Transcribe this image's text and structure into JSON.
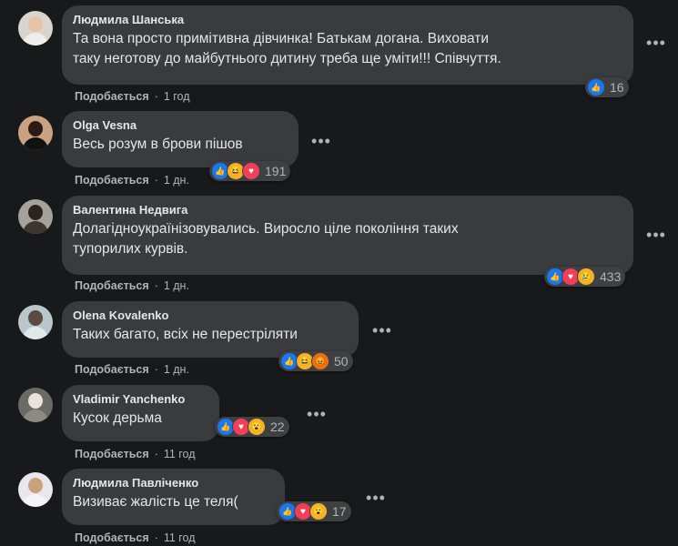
{
  "comments": [
    {
      "author": "Людмила Шанська",
      "text": "Та вона просто примітивна дівчинка! Батькам догана. Виховати\nтаку неготову до майбутнього дитину треба ще уміти!!! Співчуття.",
      "like_label": "Подобається",
      "time": "1 год",
      "reactions": [
        "like"
      ],
      "reaction_count": "16",
      "avatar_colors": {
        "bg": "#d9d4ce",
        "head": "#e6c4a6",
        "body": "#f0eeea"
      }
    },
    {
      "author": "Olga Vesna",
      "text": "Весь розум в брови пішов",
      "like_label": "Подобається",
      "time": "1 дн.",
      "reactions": [
        "like",
        "haha",
        "love"
      ],
      "reaction_count": "191",
      "avatar_colors": {
        "bg": "#caa183",
        "head": "#2a1b14",
        "body": "#111111"
      }
    },
    {
      "author": "Валентина Недвига",
      "text": "Долагідноукраїнізовувались. Виросло ціле покоління таких\nтупорилих курвів.",
      "like_label": "Подобається",
      "time": "1 дн.",
      "reactions": [
        "like",
        "love",
        "sad"
      ],
      "reaction_count": "433",
      "avatar_colors": {
        "bg": "#a5a29c",
        "head": "#2b2320",
        "body": "#3c3530"
      }
    },
    {
      "author": "Olena Kovalenko",
      "text": "Таких багато, всіх не перестріляти",
      "like_label": "Подобається",
      "time": "1 дн.",
      "reactions": [
        "like",
        "haha",
        "angry"
      ],
      "reaction_count": "50",
      "avatar_colors": {
        "bg": "#b9c6cc",
        "head": "#5b4a40",
        "body": "#dfe7ea"
      }
    },
    {
      "author": "Vladimir Yanchenko",
      "text": "Кусок дерьма",
      "like_label": "Подобається",
      "time": "11 год",
      "reactions": [
        "like",
        "love",
        "wow"
      ],
      "reaction_count": "22",
      "avatar_colors": {
        "bg": "#6b6a66",
        "head": "#e8e2da",
        "body": "#8d8a84"
      }
    },
    {
      "author": "Людмила Павліченко",
      "text": "Визиває жалість це теля(",
      "like_label": "Подобається",
      "time": "11 год",
      "reactions": [
        "like",
        "love",
        "wow"
      ],
      "reaction_count": "17",
      "avatar_colors": {
        "bg": "#e9e6ee",
        "head": "#c8a27a",
        "body": "#f4f4f7"
      }
    }
  ],
  "icons": {
    "like": "like-icon",
    "love": "love-icon",
    "haha": "haha-icon",
    "wow": "wow-icon",
    "sad": "sad-icon",
    "angry": "angry-icon",
    "more": "more-options-icon"
  },
  "colors": {
    "background": "#18191a",
    "bubble": "#3a3b3c",
    "like": "#1877f2",
    "love": "#f33e58",
    "yellow": "#f7b125"
  }
}
